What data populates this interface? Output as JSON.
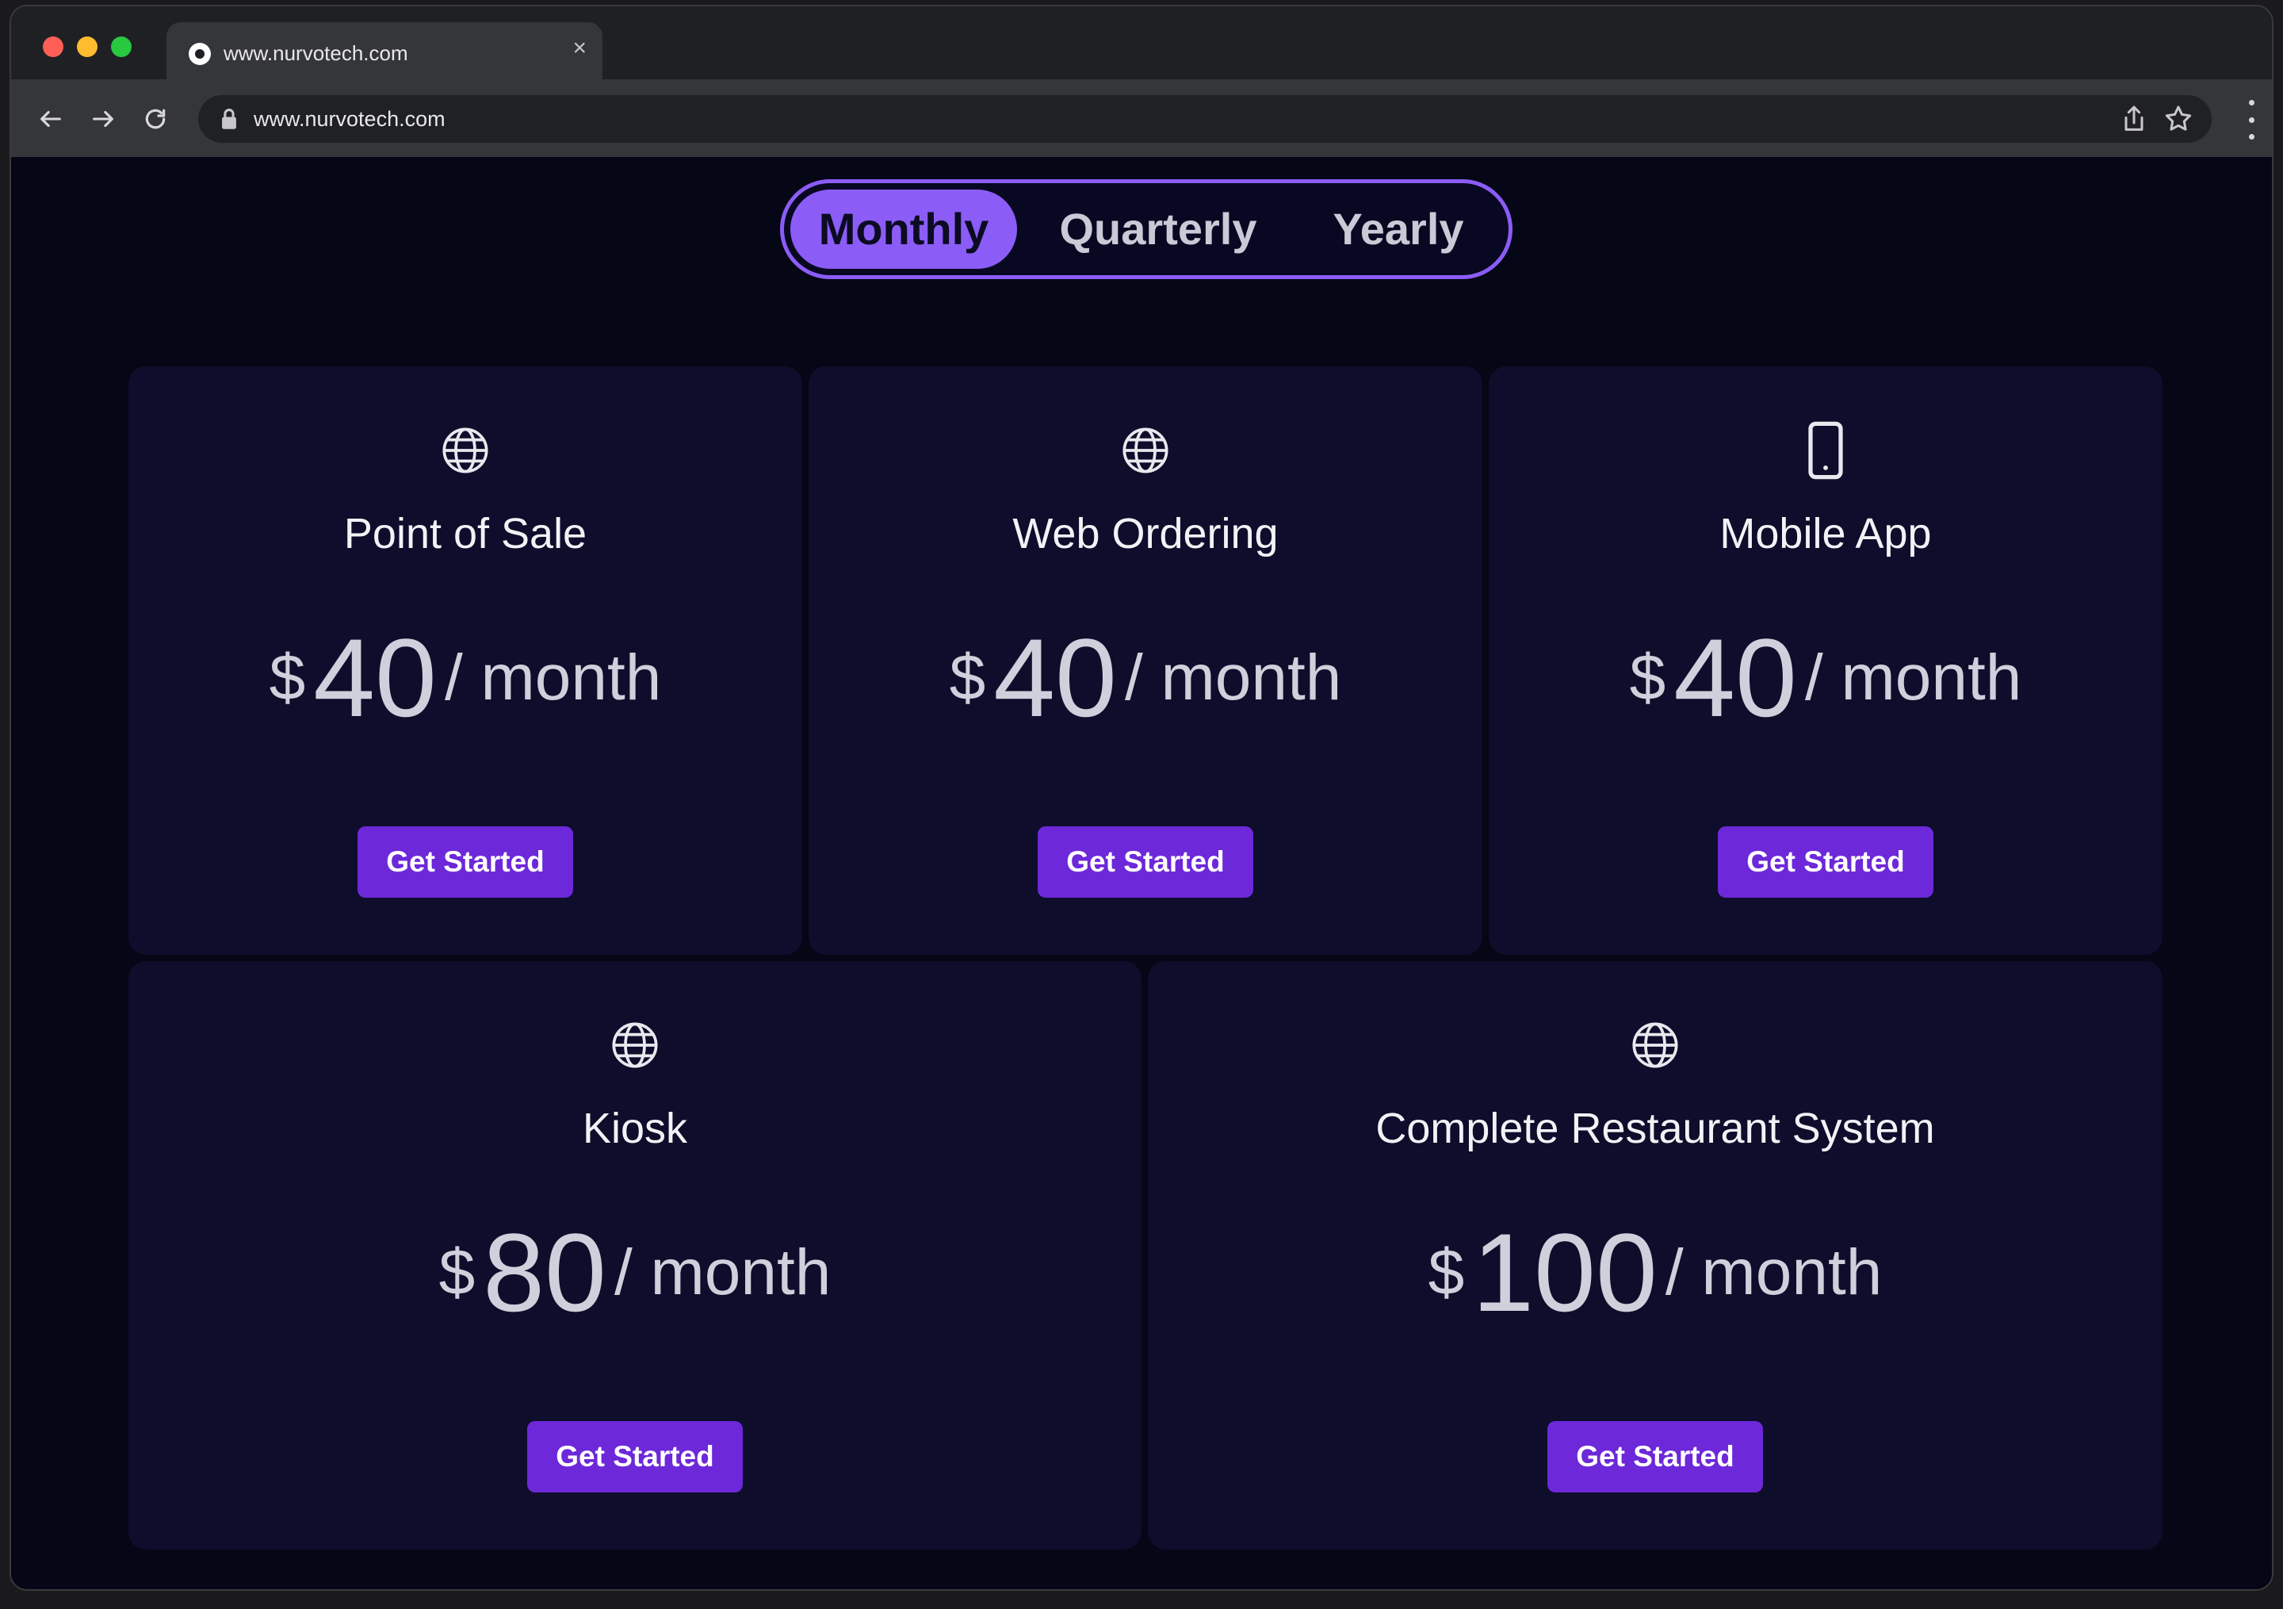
{
  "browser": {
    "tab_title": "www.nurvotech.com",
    "tab_close": "×",
    "url": "www.nurvotech.com"
  },
  "billing_toggle": {
    "options": [
      "Monthly",
      "Quarterly",
      "Yearly"
    ],
    "selected": "Monthly"
  },
  "plans": [
    {
      "icon": "globe-icon",
      "name": "Point of Sale",
      "currency": "$",
      "price": "40",
      "period": "/ month",
      "cta": "Get Started"
    },
    {
      "icon": "globe-icon",
      "name": "Web Ordering",
      "currency": "$",
      "price": "40",
      "period": "/ month",
      "cta": "Get Started"
    },
    {
      "icon": "mobile-phone-icon",
      "name": "Mobile App",
      "currency": "$",
      "price": "40",
      "period": "/ month",
      "cta": "Get Started"
    },
    {
      "icon": "globe-icon",
      "name": "Kiosk",
      "currency": "$",
      "price": "80",
      "period": "/ month",
      "cta": "Get Started"
    },
    {
      "icon": "globe-icon",
      "name": "Complete Restaurant System",
      "currency": "$",
      "price": "100",
      "period": "/ month",
      "cta": "Get Started"
    }
  ],
  "colors": {
    "accent": "#8b5cf6",
    "button": "#6d28d9",
    "card": "#0e0d2b",
    "page_bg": "#050616"
  }
}
